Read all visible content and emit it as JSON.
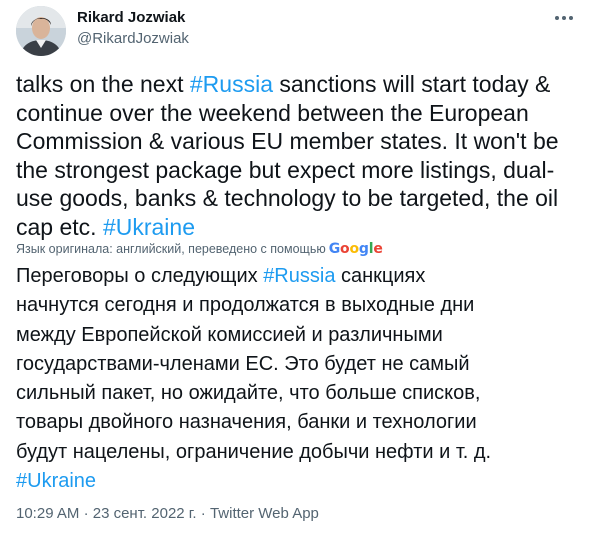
{
  "author": {
    "name": "Rikard Jozwiak",
    "handle": "@RikardJozwiak"
  },
  "tweet": {
    "original_lines": [
      [
        {
          "t": "talks on the next ",
          "tag": false
        },
        {
          "t": "#Russia",
          "tag": true
        },
        {
          "t": " sanctions will start today &",
          "tag": false
        }
      ],
      [
        {
          "t": "continue over the weekend between the European",
          "tag": false
        }
      ],
      [
        {
          "t": "Commission & various EU member states. It won't be",
          "tag": false
        }
      ],
      [
        {
          "t": "the strongest package but expect more listings, dual-",
          "tag": false
        }
      ],
      [
        {
          "t": "use goods, banks & technology to be targeted, the oil",
          "tag": false
        }
      ],
      [
        {
          "t": "cap etc. ",
          "tag": false
        },
        {
          "t": "#Ukraine",
          "tag": true
        }
      ]
    ],
    "translation_notice": "Язык оригинала: английский, переведено с помощью",
    "translator_logo": {
      "text": "Google",
      "letters": [
        {
          "ch": "G",
          "color": "#4285f4"
        },
        {
          "ch": "o",
          "color": "#ea4335"
        },
        {
          "ch": "o",
          "color": "#fbbc05"
        },
        {
          "ch": "g",
          "color": "#4285f4"
        },
        {
          "ch": "l",
          "color": "#34a853"
        },
        {
          "ch": "e",
          "color": "#ea4335"
        }
      ]
    },
    "translated_lines": [
      [
        {
          "t": "Переговоры о следующих ",
          "tag": false
        },
        {
          "t": "#Russia",
          "tag": true
        },
        {
          "t": " санкциях",
          "tag": false
        }
      ],
      [
        {
          "t": "начнутся сегодня и продолжатся в выходные дни",
          "tag": false
        }
      ],
      [
        {
          "t": "между Европейской комиссией и различными",
          "tag": false
        }
      ],
      [
        {
          "t": "государствами-членами ЕС. Это будет не самый",
          "tag": false
        }
      ],
      [
        {
          "t": "сильный пакет, но ожидайте, что больше списков,",
          "tag": false
        }
      ],
      [
        {
          "t": "товары двойного назначения, банки и технологии",
          "tag": false
        }
      ],
      [
        {
          "t": "будут нацелены, ограничение добычи нефти и т. д.",
          "tag": false
        }
      ],
      [
        {
          "t": "#Ukraine",
          "tag": true
        }
      ]
    ],
    "time": "10:29 AM",
    "separator": "·",
    "date": "23 сент. 2022 г.",
    "source": "Twitter Web App"
  },
  "colors": {
    "hashtag": "#1d9bf0",
    "secondary_text": "#536471",
    "primary_text": "#0f1419"
  },
  "icons": {
    "more": "more-horizontal-icon"
  }
}
